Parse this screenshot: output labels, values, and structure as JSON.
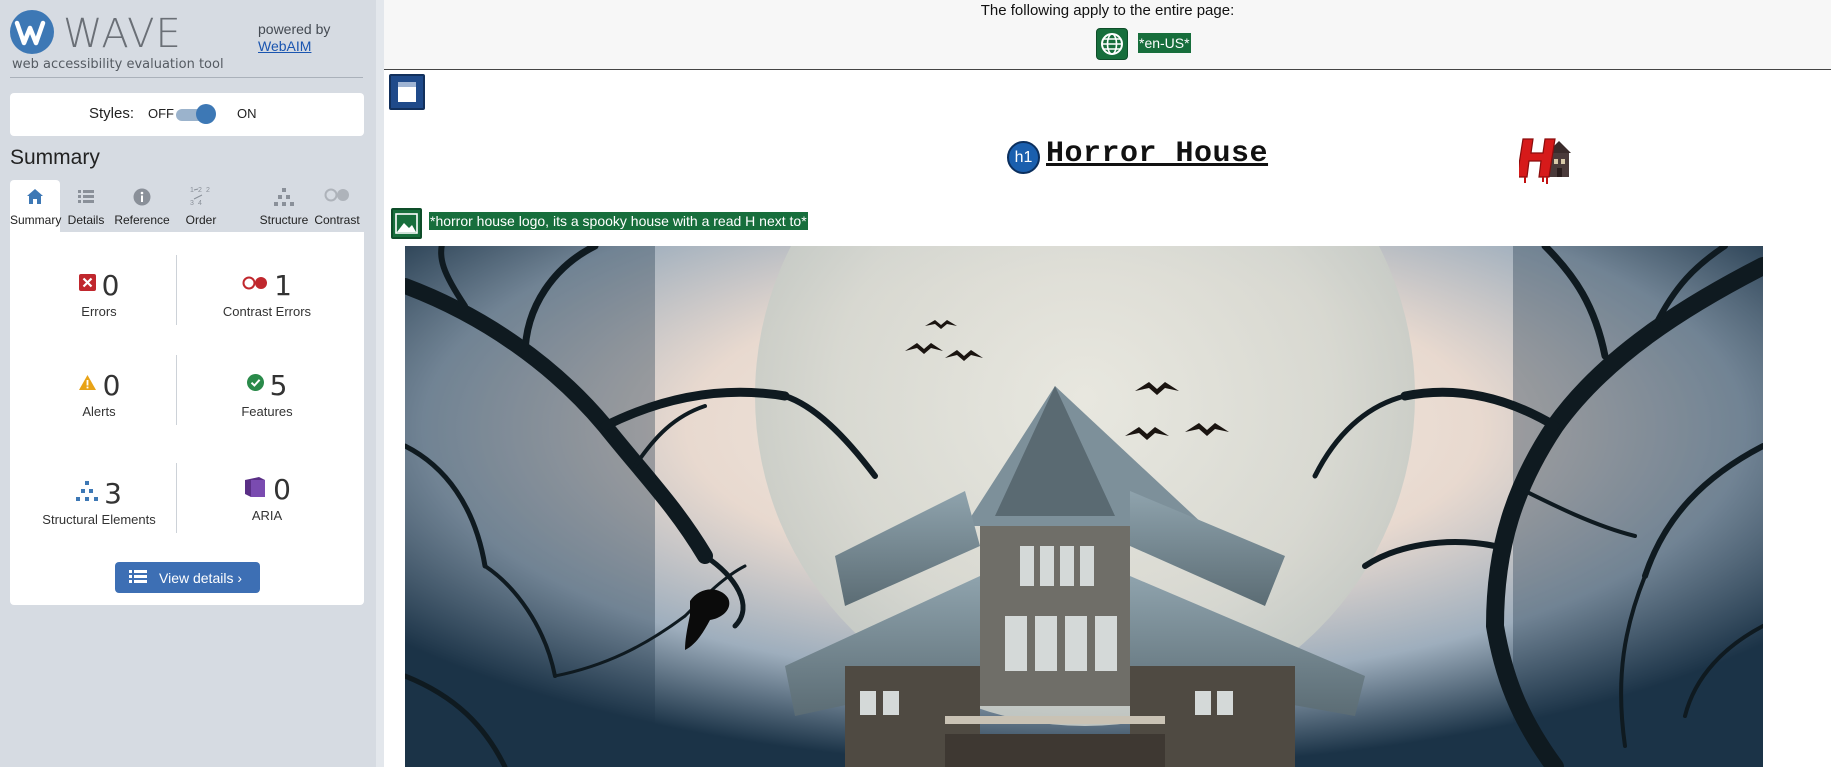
{
  "sidebar": {
    "brand_name": "WAVE",
    "brand_tagline": "web accessibility evaluation tool",
    "powered_by": "powered by",
    "webaim_link": "WebAIM",
    "styles": {
      "label": "Styles:",
      "off_label": "OFF",
      "on_label": "ON",
      "state": "on"
    },
    "summary_heading": "Summary",
    "tabs": [
      {
        "label": "Summary",
        "icon": "home-icon",
        "active": true
      },
      {
        "label": "Details",
        "icon": "list-icon",
        "active": false
      },
      {
        "label": "Reference",
        "icon": "info-icon",
        "active": false
      },
      {
        "label": "Order",
        "icon": "order-icon",
        "active": false
      },
      {
        "label": "Structure",
        "icon": "structure-icon",
        "active": false
      },
      {
        "label": "Contrast",
        "icon": "contrast-icon",
        "active": false
      }
    ],
    "stats": {
      "errors": {
        "count": "0",
        "label": "Errors",
        "icon": "error-icon"
      },
      "contrast_errors": {
        "count": "1",
        "label": "Contrast Errors",
        "icon": "contrast-error-icon"
      },
      "alerts": {
        "count": "0",
        "label": "Alerts",
        "icon": "alert-icon"
      },
      "features": {
        "count": "5",
        "label": "Features",
        "icon": "feature-check-icon"
      },
      "structural": {
        "count": "3",
        "label": "Structural Elements",
        "icon": "structure-icon"
      },
      "aria": {
        "count": "0",
        "label": "ARIA",
        "icon": "aria-icon"
      }
    },
    "view_details_label": "View details ›"
  },
  "page": {
    "banner_text": "The following apply to the entire page:",
    "language_label": "*en-US*",
    "h1_badge": "h1",
    "title": "Horror House",
    "image_alt_label": "*horror house logo, its a spooky house with a read H next to*"
  },
  "colors": {
    "sidebar_bg": "#d6dbe2",
    "accent_blue": "#3d78b5",
    "feature_green": "#176e3c",
    "error_red": "#c0272d",
    "alert_orange": "#e8a317",
    "aria_purple": "#5a2f86"
  }
}
